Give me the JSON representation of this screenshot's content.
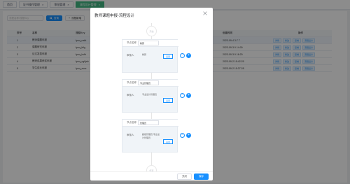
{
  "tabs": [
    {
      "label": "首页",
      "active": false
    },
    {
      "label": "证书操作管理",
      "active": false
    },
    {
      "label": "审批管理",
      "active": false
    },
    {
      "label": "流程设计管理",
      "active": true
    }
  ],
  "toolbar": {
    "search_placeholder": "流程名称/流程Key",
    "search_label": "查询",
    "add_label": "流程新增"
  },
  "table": {
    "headers": [
      "序号",
      "名称",
      "流程Key",
      "",
      "创建时间",
      "操作"
    ],
    "rows": [
      {
        "idx": "1",
        "name": "教师课题申报",
        "key": "fpzq_nakt",
        "time": "2023-09-4 3:7 7",
        "ops": [
          "详情",
          "修改",
          "复制",
          "流程设计"
        ]
      },
      {
        "idx": "2",
        "name": "课题研究申报",
        "key": "fpzq_ktlg",
        "time": "2023-09-3 9 14:00",
        "ops": [
          "详情",
          "修改",
          "复制",
          "流程设计"
        ]
      },
      {
        "idx": "3",
        "name": "论文发表申报",
        "key": "fpzq_lwfb",
        "time": "2023-09-3 9 16:20",
        "ops": [
          "详情",
          "修改",
          "复制",
          "流程设计"
        ]
      },
      {
        "idx": "4",
        "name": "教研成果获奖申报",
        "key": "fpzq_cghjsb",
        "time": "2023-09-2 15:42:25",
        "ops": [
          "详情",
          "修改",
          "复制",
          "流程设计"
        ]
      },
      {
        "idx": "5",
        "name": "学生成长申报",
        "key": "fpzq_xscz",
        "time": "2023-09-2 15:37:28",
        "ops": [
          "详情",
          "修改",
          "复制",
          "流程设计"
        ]
      }
    ]
  },
  "modal": {
    "title": "教师课题申报-流程设计",
    "start_label": "开始",
    "end_label": "结束",
    "cancel_label": "关闭",
    "save_label": "保存",
    "nodes": [
      {
        "name_label": "节点名称",
        "name_value": "教研",
        "approver_label": "审核人",
        "approver_value": "教研",
        "set_label": "设置"
      },
      {
        "name_label": "节点名称",
        "name_value": "专业管理员",
        "approver_label": "审核人",
        "approver_value": "专业设计管理员",
        "set_label": "设置"
      },
      {
        "name_label": "节点名称",
        "name_value": "管理员",
        "approver_label": "审核人",
        "approver_value": "超级管理员,专业设计管理员",
        "set_label": "设置"
      }
    ]
  },
  "colors": {
    "primary": "#1890ff",
    "active_tab": "#42b983"
  }
}
